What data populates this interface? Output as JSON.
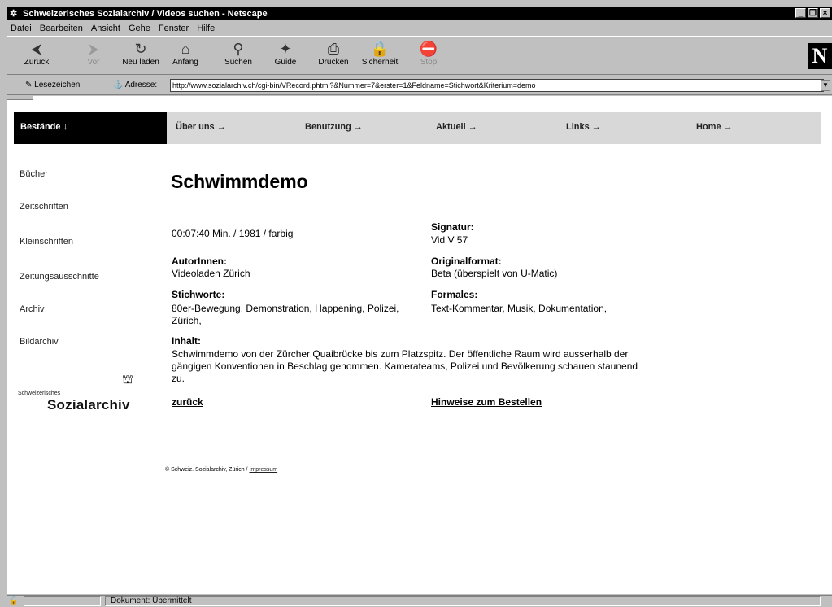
{
  "window": {
    "title": "Schweizerisches Sozialarchiv / Videos suchen - Netscape",
    "controls": [
      "_",
      "❐",
      "×"
    ]
  },
  "menu": [
    "Datei",
    "Bearbeiten",
    "Ansicht",
    "Gehe",
    "Fenster",
    "Hilfe"
  ],
  "toolbar": {
    "buttons": [
      {
        "label": "Zurück",
        "icon": "back-arrow-icon",
        "glyph": "⮜"
      },
      {
        "label": "Vor",
        "icon": "forward-arrow-icon",
        "glyph": "⮞"
      },
      {
        "label": "Neu laden",
        "icon": "reload-icon",
        "glyph": "↻"
      },
      {
        "label": "Anfang",
        "icon": "home-icon",
        "glyph": "⌂"
      },
      {
        "label": "Suchen",
        "icon": "search-icon",
        "glyph": "⚲"
      },
      {
        "label": "Guide",
        "icon": "guide-icon",
        "glyph": "✦"
      },
      {
        "label": "Drucken",
        "icon": "print-icon",
        "glyph": "⎙"
      },
      {
        "label": "Sicherheit",
        "icon": "security-lock-icon",
        "glyph": "🔒"
      },
      {
        "label": "Stop",
        "icon": "stop-icon",
        "glyph": "⛔"
      }
    ],
    "logo": "N"
  },
  "location": {
    "bookmarks_label": "Lesezeichen",
    "address_label": "Adresse:",
    "url": "http://www.sozialarchiv.ch/cgi-bin/VRecord.phtml?&Nummer=7&erster=1&Feldname=Stichwort&Kriterium=demo"
  },
  "nav": {
    "active": "Bestände ↓",
    "items": [
      "Über uns →",
      "Benutzung →",
      "Aktuell →",
      "Links →",
      "Home →"
    ]
  },
  "sidebar": [
    "Bücher",
    "Zeitschriften",
    "Kleinschriften",
    "Zeitungsausschnitte",
    "Archiv",
    "Bildarchiv"
  ],
  "logo": {
    "small": "Schweizerisches",
    "big": "Sozialarchiv"
  },
  "record": {
    "title": "Schwimmdemo",
    "meta": "00:07:40 Min. / 1981 / farbig",
    "signatur_label": "Signatur:",
    "signatur": "Vid V 57",
    "autorinnen_label": "AutorInnen:",
    "autorinnen": "Videoladen Zürich",
    "originalformat_label": "Originalformat:",
    "originalformat": "Beta (überspielt von U-Matic)",
    "stichworte_label": "Stichworte:",
    "stichworte": "80er-Bewegung, Demonstration, Happening, Polizei, Zürich,",
    "formales_label": "Formales:",
    "formales": "Text-Kommentar, Musik, Dokumentation,",
    "inhalt_label": "Inhalt:",
    "inhalt": "Schwimmdemo von der Zürcher Quaibrücke bis zum Platzspitz. Der öffentliche Raum wird ausserhalb der gängigen Konventionen in Beschlag genommen. Kamerateams, Polizei und Bevölkerung schauen staunend zu.",
    "back_link": "zurück",
    "order_link": "Hinweise zum Bestellen"
  },
  "footer": {
    "text": "© Schweiz. Sozialarchiv, Zürich / ",
    "link": "Impressum"
  },
  "status": {
    "message": "Dokument: Übermittelt"
  }
}
